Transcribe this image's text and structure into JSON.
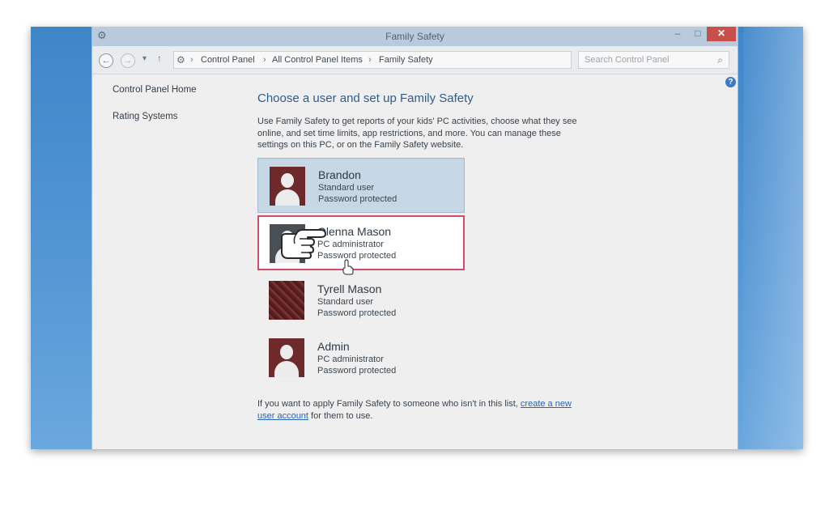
{
  "window": {
    "title": "Family Safety",
    "minimize_glyph": "–",
    "maximize_glyph": "□",
    "close_glyph": "✕"
  },
  "navbar": {
    "breadcrumbs": [
      "Control Panel",
      "All Control Panel Items",
      "Family Safety"
    ],
    "separator": "›",
    "search_placeholder": "Search Control Panel"
  },
  "left_nav": {
    "items": [
      "Control Panel Home",
      "Rating Systems"
    ]
  },
  "main": {
    "heading": "Choose a user and set up Family Safety",
    "description": "Use Family Safety to get reports of your kids' PC activities, choose what they see online, and set time limits, app restrictions, and more. You can manage these settings on this PC, or on the Family Safety website.",
    "users": [
      {
        "name": "Brandon",
        "role": "Standard user",
        "protection": "Password protected",
        "state": "hover"
      },
      {
        "name": "Olenna Mason",
        "role": "PC administrator",
        "protection": "Password protected",
        "state": "selected"
      },
      {
        "name": "Tyrell Mason",
        "role": "Standard user",
        "protection": "Password protected",
        "state": "normal"
      },
      {
        "name": "Admin",
        "role": "PC administrator",
        "protection": "Password protected",
        "state": "normal"
      }
    ],
    "footer_prefix": "If you want to apply Family Safety to someone who isn't in this list,",
    "footer_link": "create a new user account",
    "footer_suffix": "for them to use."
  },
  "colors": {
    "selected_border": "#d9486c",
    "heading": "#2e5d8f",
    "link": "#2a63b5",
    "desktop": "#4f93d2"
  },
  "icons": {
    "back": "back-arrow-icon",
    "forward": "forward-arrow-icon",
    "up": "up-arrow-icon",
    "refresh": "refresh-icon",
    "search": "search-icon",
    "help": "help-icon",
    "pointer": "pointing-hand-icon",
    "cursor": "hand-cursor-icon"
  }
}
